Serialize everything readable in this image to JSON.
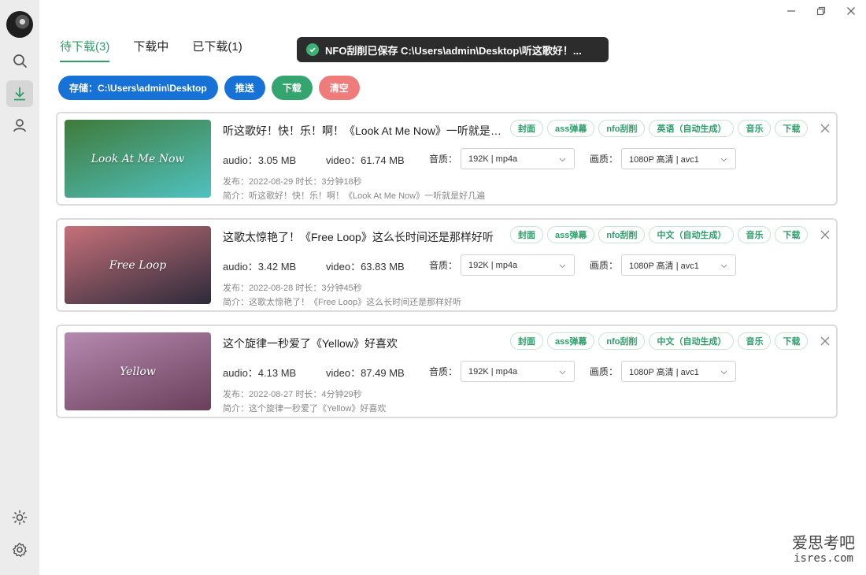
{
  "tabs": [
    {
      "label": "待下载(3)",
      "active": true
    },
    {
      "label": "下载中",
      "active": false
    },
    {
      "label": "已下载(1)",
      "active": false
    }
  ],
  "toast": {
    "message": "NFO刮削已保存 C:\\Users\\admin\\Desktop\\听这歌好！..."
  },
  "actions": {
    "storage": "存储：C:\\Users\\admin\\Desktop",
    "push": "推送",
    "download": "下载",
    "clear": "清空"
  },
  "labels": {
    "quality_audio": "音质：",
    "quality_video": "画质："
  },
  "items": [
    {
      "thumb_text": "Look At Me Now",
      "title": "听这歌好！快！乐！啊！《Look At Me Now》一听就是好几遍",
      "tags": [
        "封面",
        "ass弹幕",
        "nfo刮削",
        "英语（自动生成）",
        "音乐",
        "下载"
      ],
      "audio": "audio：3.05 MB",
      "video": "video：61.74 MB",
      "audio_quality": "192K | mp4a",
      "video_quality": "1080P 高清 | avc1",
      "publish": "发布：2022-08-29 时长：3分钟18秒",
      "intro": "简介：听这歌好！快！乐！啊！《Look At Me Now》一听就是好几遍",
      "colors": {
        "top": "#3f7a3a",
        "bottom": "#4fc2c0"
      }
    },
    {
      "thumb_text": "Free Loop",
      "title": "这歌太惊艳了！《Free Loop》这么长时间还是那样好听",
      "tags": [
        "封面",
        "ass弹幕",
        "nfo刮削",
        "中文（自动生成）",
        "音乐",
        "下载"
      ],
      "audio": "audio：3.42 MB",
      "video": "video：63.83 MB",
      "audio_quality": "192K | mp4a",
      "video_quality": "1080P 高清 | avc1",
      "publish": "发布：2022-08-28 时长：3分钟45秒",
      "intro": "简介：这歌太惊艳了！《Free Loop》这么长时间还是那样好听",
      "colors": {
        "top": "#c6717a",
        "bottom": "#2d2a3a"
      }
    },
    {
      "thumb_text": "Yellow",
      "title": "这个旋律一秒爱了《Yellow》好喜欢",
      "tags": [
        "封面",
        "ass弹幕",
        "nfo刮削",
        "中文（自动生成）",
        "音乐",
        "下载"
      ],
      "audio": "audio：4.13 MB",
      "video": "video：87.49 MB",
      "audio_quality": "192K | mp4a",
      "video_quality": "1080P 高清 | avc1",
      "publish": "发布：2022-08-27 时长：4分钟29秒",
      "intro": "简介：这个旋律一秒爱了《Yellow》好喜欢",
      "colors": {
        "top": "#b58ab0",
        "bottom": "#6a3f5a"
      }
    }
  ],
  "watermark": {
    "title": "爱思考吧",
    "sub": "isres.com"
  },
  "accent": "#2e9d6a"
}
